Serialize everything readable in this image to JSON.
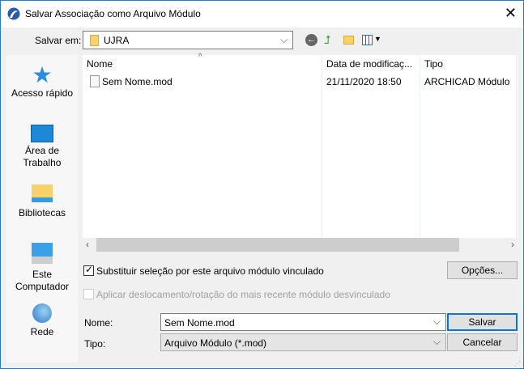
{
  "title": "Salvar Associação como Arquivo Módulo",
  "save_in": {
    "label": "Salvar em:",
    "value": "UJRA"
  },
  "sidebar": [
    {
      "label": "Acesso rápido"
    },
    {
      "label": "Área de Trabalho"
    },
    {
      "label": "Bibliotecas"
    },
    {
      "label": "Este Computador"
    },
    {
      "label": "Rede"
    }
  ],
  "columns": [
    "Nome",
    "Data de modificaç...",
    "Tipo"
  ],
  "files": [
    {
      "name": "Sem Nome.mod",
      "date": "21/11/2020 18:50",
      "type": "ARCHICAD Módulo"
    }
  ],
  "options": {
    "replace_label": "Substituir seleção por este arquivo módulo vinculado",
    "replace_checked": true,
    "apply_label": "Aplicar deslocamento/rotação do mais recente módulo desvinculado",
    "apply_checked": false,
    "options_button": "Opções..."
  },
  "name_field": {
    "label": "Nome:",
    "value": "Sem Nome.mod"
  },
  "type_field": {
    "label": "Tipo:",
    "value": "Arquivo Módulo (*.mod)"
  },
  "buttons": {
    "save": "Salvar",
    "cancel": "Cancelar"
  },
  "accent": "#0078d7"
}
